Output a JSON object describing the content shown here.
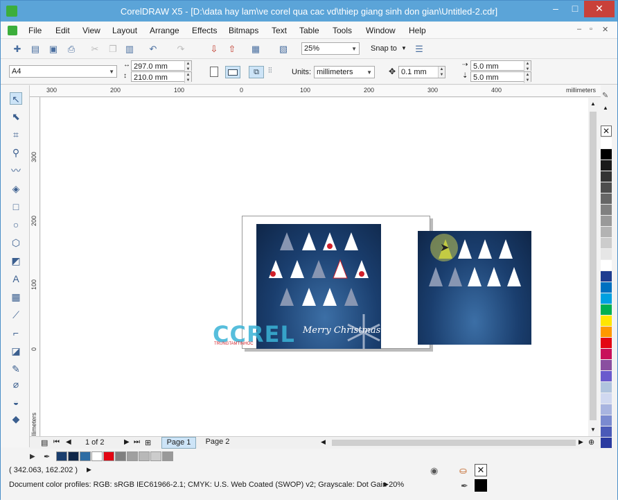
{
  "window": {
    "title": "CorelDRAW X5 - [D:\\data hay lam\\ve corel qua cac vd\\thiep giang sinh don gian\\Untitled-2.cdr]",
    "controls": [
      "–",
      "□",
      "✕"
    ]
  },
  "menu": [
    "File",
    "Edit",
    "View",
    "Layout",
    "Arrange",
    "Effects",
    "Bitmaps",
    "Text",
    "Table",
    "Tools",
    "Window",
    "Help"
  ],
  "toolbar": {
    "zoom": "25%",
    "snap_to": "Snap to"
  },
  "propertybar": {
    "paper": "A4",
    "width": "297.0 mm",
    "height": "210.0 mm",
    "units_label": "Units:",
    "units": "millimeters",
    "nudge": "0.1 mm",
    "dup_x": "5.0 mm",
    "dup_y": "5.0 mm"
  },
  "ruler": {
    "h_labels": [
      "300",
      "200",
      "100",
      "0",
      "100",
      "200",
      "300",
      "400"
    ],
    "h_unit": "millimeters",
    "v_labels": [
      "300",
      "200",
      "100",
      "0"
    ],
    "v_unit": "millimeters"
  },
  "navigator": {
    "page_count": "1 of 2",
    "tabs": [
      "Page 1",
      "Page 2"
    ]
  },
  "canvas": {
    "watermark": "CCREL",
    "watermark_sub": "TRUNGTAMTINHOC",
    "greeting": "Merry Christmas"
  },
  "status": {
    "cursor": "( 342.063, 162.202 )",
    "profiles": "Document color profiles: RGB: sRGB IEC61966-2.1; CMYK: U.S. Web Coated (SWOP) v2; Grayscale: Dot Gain 20%"
  },
  "palette_colors": [
    "#ffffff",
    "#000000",
    "#1a1a1a",
    "#333333",
    "#4d4d4d",
    "#666666",
    "#808080",
    "#999999",
    "#b3b3b3",
    "#cccccc",
    "#e6e6e6",
    "#ffffff",
    "#1d3c8f",
    "#0070c0",
    "#00a0e0",
    "#00b050",
    "#ffe600",
    "#ff9900",
    "#e30613",
    "#c8105a",
    "#8a4fa0",
    "#6a5acd",
    "#b0c4de",
    "#d0d8f0",
    "#a8b4e0",
    "#7a8ad0",
    "#4a5ab8",
    "#2a3aa0"
  ],
  "bottom_swatches": [
    "#1a3e6e",
    "#0f2648",
    "#2e6da4",
    "#ffffff",
    "#e30613",
    "#808080",
    "#a0a0a0",
    "#b8b8b8",
    "#cccccc",
    "#999999"
  ]
}
